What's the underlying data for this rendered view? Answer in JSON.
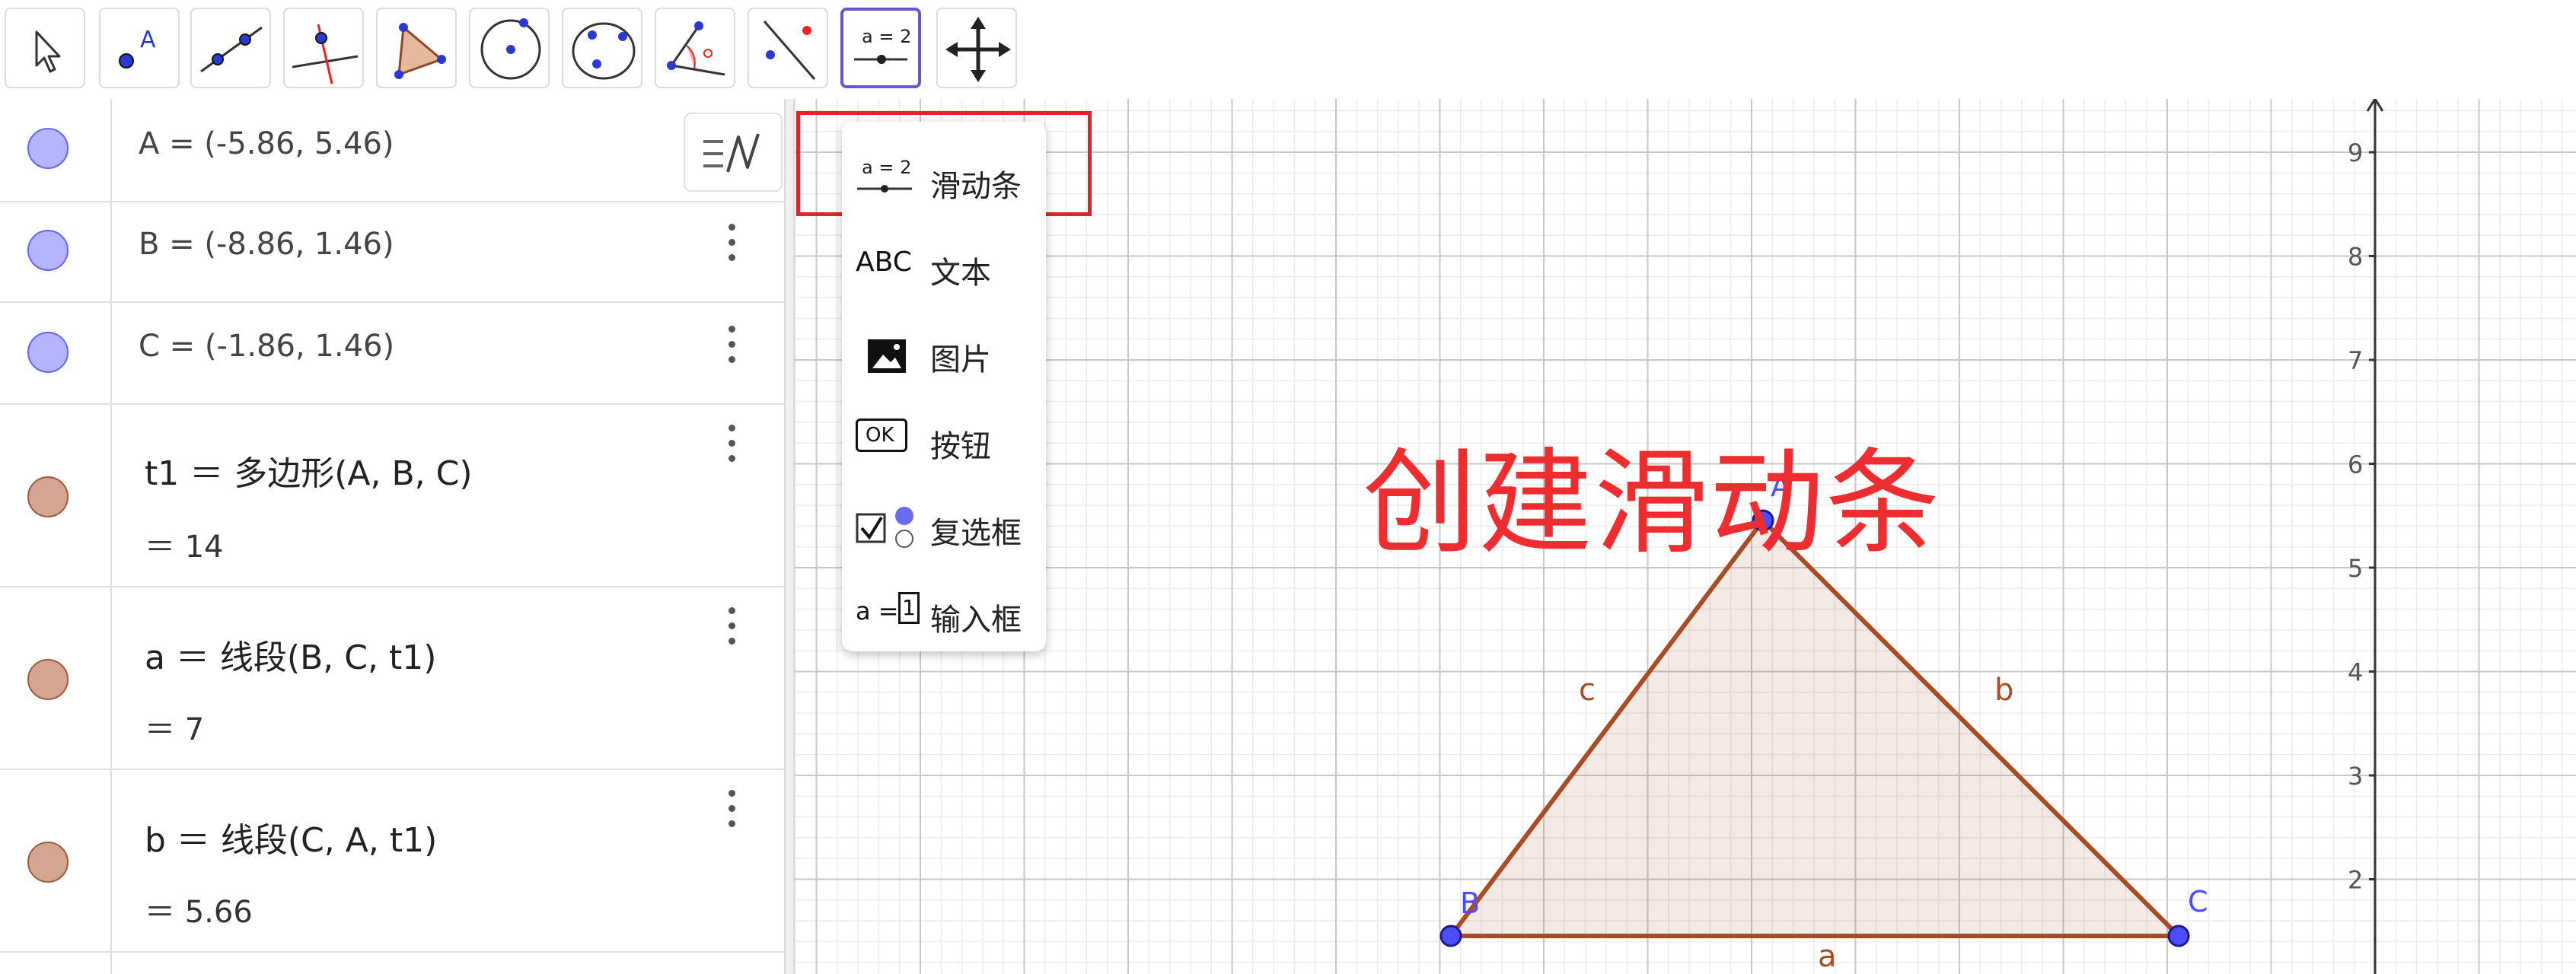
{
  "toolbar": {
    "tools": [
      {
        "name": "move-tool"
      },
      {
        "name": "point-tool",
        "label": "A"
      },
      {
        "name": "line-tool"
      },
      {
        "name": "perpendicular-line-tool"
      },
      {
        "name": "polygon-tool"
      },
      {
        "name": "circle-center-point-tool"
      },
      {
        "name": "circle-three-points-tool"
      },
      {
        "name": "angle-tool"
      },
      {
        "name": "reflect-tool"
      },
      {
        "name": "slider-tool",
        "label": "a = 2",
        "active": true
      },
      {
        "name": "move-graphics-view-tool"
      }
    ]
  },
  "algebra": {
    "rows": [
      {
        "id": "A",
        "definition": "A = (-5.86, 5.46)",
        "color": "#b4b4ff",
        "border": "#6464ff"
      },
      {
        "id": "B",
        "definition": "B = (-8.86, 1.46)",
        "color": "#b4b4ff",
        "border": "#6464ff"
      },
      {
        "id": "C",
        "definition": "C = (-1.86, 1.46)",
        "color": "#b4b4ff",
        "border": "#6464ff"
      },
      {
        "id": "t1",
        "definition": "t1 ＝ 多边形(A, B, C)",
        "value": "＝ 14",
        "color": "#d4a590",
        "border": "#a05a3c"
      },
      {
        "id": "a",
        "definition": "a ＝ 线段(B, C, t1)",
        "value": "＝ 7",
        "color": "#d4a590",
        "border": "#a05a3c"
      },
      {
        "id": "b",
        "definition": "b ＝ 线段(C, A, t1)",
        "value": "＝ 5.66",
        "color": "#d4a590",
        "border": "#a05a3c"
      }
    ]
  },
  "dropdown": {
    "items": [
      {
        "key": "slider",
        "label": "滑动条",
        "icon_text": "a = 2"
      },
      {
        "key": "text",
        "label": "文本",
        "icon_text": "ABC"
      },
      {
        "key": "image",
        "label": "图片"
      },
      {
        "key": "button",
        "label": "按钮",
        "icon_text": "OK"
      },
      {
        "key": "checkbox",
        "label": "复选框"
      },
      {
        "key": "inputbox",
        "label": "输入框",
        "icon_text": "a =",
        "icon_value": "1"
      }
    ]
  },
  "overlay": {
    "title": "创建滑动条"
  },
  "graphics": {
    "y_ticks": [
      "9",
      "8",
      "7",
      "6",
      "5",
      "4",
      "3",
      "2"
    ],
    "points": {
      "A": "A",
      "B": "B",
      "C": "C"
    },
    "segments": {
      "a": "a",
      "b": "b",
      "c": "c"
    },
    "colors": {
      "point": "#4d4dff",
      "segment": "#a64d26",
      "polygon_fill": "#f3dcd2",
      "grid_major": "#c8c8c8",
      "grid_minor": "#ececec",
      "highlight": "#e8202a"
    }
  }
}
